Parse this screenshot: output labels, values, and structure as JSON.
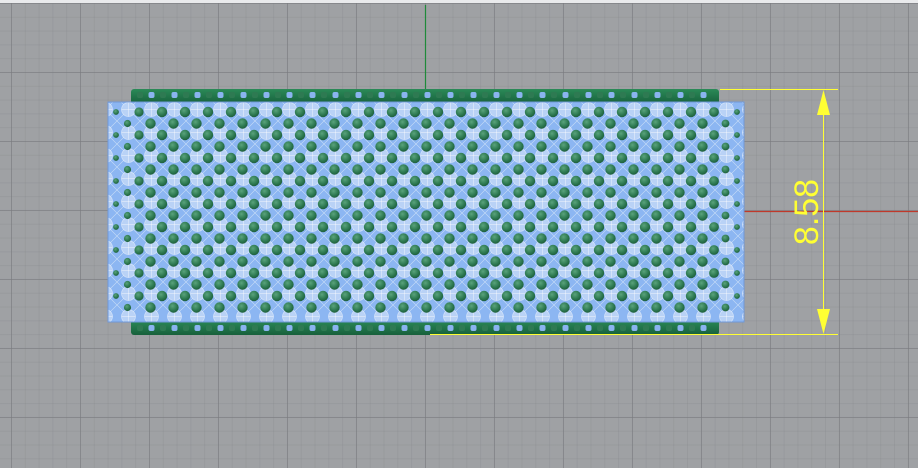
{
  "viewport": {
    "view": "Front",
    "axis_colors": {
      "x": "#c0392b",
      "y": "#1f8a3a"
    },
    "background": "#9fa1a4"
  },
  "model": {
    "name": "lattice-ring-band",
    "core_color": "#8ab4f0",
    "bead_color": "#2e7a52",
    "rim_color": "#1f7a4a"
  },
  "dimension": {
    "value": "8.58",
    "color": "#ffff33"
  }
}
